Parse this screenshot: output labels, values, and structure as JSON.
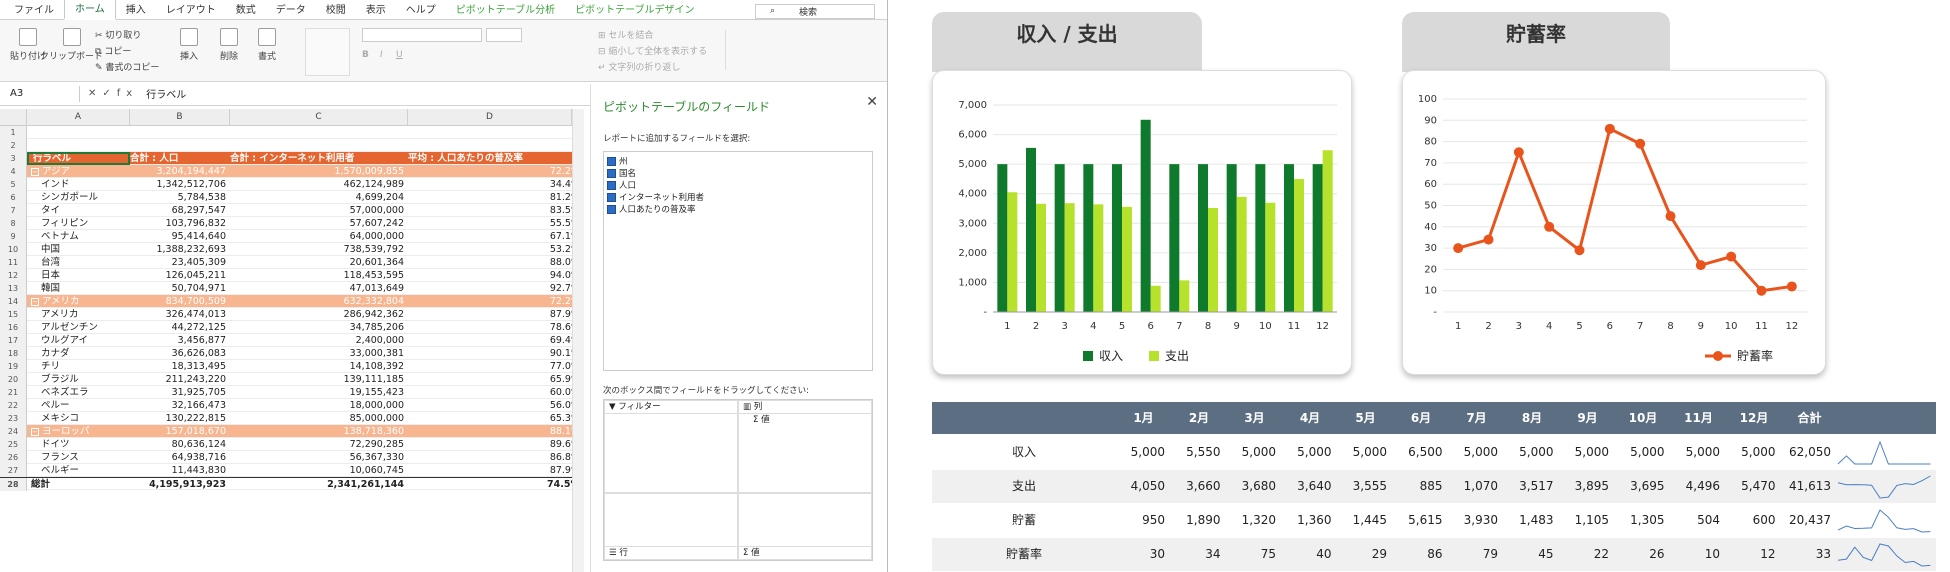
{
  "excel": {
    "tabs": [
      "ファイル",
      "ホーム",
      "挿入",
      "レイアウト",
      "数式",
      "データ",
      "校閲",
      "表示",
      "ヘルプ",
      "ピボットテーブル分析",
      "ピボットテーブルデザイン"
    ],
    "active_tab": "ホーム",
    "search_placeholder": "検索",
    "ribbon": {
      "paste": "貼り付け",
      "clipboard": "クリップボード",
      "cut": "切り取り",
      "copy": "コピー",
      "format_painter": "書式のコピー",
      "insert": "挿入",
      "delete": "削除",
      "format": "書式",
      "merge": "セルを結合",
      "shrink": "縮小して全体を表示する",
      "wrap": "文字列の折り返し"
    },
    "name_box": "A3",
    "formula": "行ラベル",
    "columns": [
      "A",
      "B",
      "C",
      "D"
    ],
    "header_row": {
      "a": "行ラベル",
      "b": "合計 : 人口",
      "c": "合計 : インターネット利用者",
      "d": "平均 : 人口あたりの普及率"
    },
    "rows": [
      {
        "n": "4",
        "a": "アジア",
        "b": "3,204,194,447",
        "c": "1,570,009,855",
        "d": "72.2%",
        "type": "grp"
      },
      {
        "n": "5",
        "a": "インド",
        "b": "1,342,512,706",
        "c": "462,124,989",
        "d": "34.4%"
      },
      {
        "n": "6",
        "a": "シンガポール",
        "b": "5,784,538",
        "c": "4,699,204",
        "d": "81.2%"
      },
      {
        "n": "7",
        "a": "タイ",
        "b": "68,297,547",
        "c": "57,000,000",
        "d": "83.5%"
      },
      {
        "n": "8",
        "a": "フィリピン",
        "b": "103,796,832",
        "c": "57,607,242",
        "d": "55.5%"
      },
      {
        "n": "9",
        "a": "ベトナム",
        "b": "95,414,640",
        "c": "64,000,000",
        "d": "67.1%"
      },
      {
        "n": "10",
        "a": "中国",
        "b": "1,388,232,693",
        "c": "738,539,792",
        "d": "53.2%"
      },
      {
        "n": "11",
        "a": "台湾",
        "b": "23,405,309",
        "c": "20,601,364",
        "d": "88.0%"
      },
      {
        "n": "12",
        "a": "日本",
        "b": "126,045,211",
        "c": "118,453,595",
        "d": "94.0%"
      },
      {
        "n": "13",
        "a": "韓国",
        "b": "50,704,971",
        "c": "47,013,649",
        "d": "92.7%"
      },
      {
        "n": "14",
        "a": "アメリカ",
        "b": "834,700,509",
        "c": "632,332,804",
        "d": "72.2%",
        "type": "grp"
      },
      {
        "n": "15",
        "a": "アメリカ",
        "b": "326,474,013",
        "c": "286,942,362",
        "d": "87.9%"
      },
      {
        "n": "16",
        "a": "アルゼンチン",
        "b": "44,272,125",
        "c": "34,785,206",
        "d": "78.6%"
      },
      {
        "n": "17",
        "a": "ウルグアイ",
        "b": "3,456,877",
        "c": "2,400,000",
        "d": "69.4%"
      },
      {
        "n": "18",
        "a": "カナダ",
        "b": "36,626,083",
        "c": "33,000,381",
        "d": "90.1%"
      },
      {
        "n": "19",
        "a": "チリ",
        "b": "18,313,495",
        "c": "14,108,392",
        "d": "77.0%"
      },
      {
        "n": "20",
        "a": "ブラジル",
        "b": "211,243,220",
        "c": "139,111,185",
        "d": "65.9%"
      },
      {
        "n": "21",
        "a": "ベネズエラ",
        "b": "31,925,705",
        "c": "19,155,423",
        "d": "60.0%"
      },
      {
        "n": "22",
        "a": "ペルー",
        "b": "32,166,473",
        "c": "18,000,000",
        "d": "56.0%"
      },
      {
        "n": "23",
        "a": "メキシコ",
        "b": "130,222,815",
        "c": "85,000,000",
        "d": "65.3%"
      },
      {
        "n": "24",
        "a": "ヨーロッパ",
        "b": "157,018,670",
        "c": "138,718,360",
        "d": "88.1%",
        "type": "grp"
      },
      {
        "n": "25",
        "a": "ドイツ",
        "b": "80,636,124",
        "c": "72,290,285",
        "d": "89.6%"
      },
      {
        "n": "26",
        "a": "フランス",
        "b": "64,938,716",
        "c": "56,367,330",
        "d": "86.8%"
      },
      {
        "n": "27",
        "a": "ベルギー",
        "b": "11,443,830",
        "c": "10,060,745",
        "d": "87.9%"
      },
      {
        "n": "28",
        "a": "総計",
        "b": "4,195,913,923",
        "c": "2,341,261,144",
        "d": "74.5%",
        "type": "total"
      }
    ],
    "pane": {
      "title": "ピボットテーブルのフィールド",
      "subtitle": "レポートに追加するフィールドを選択:",
      "fields": [
        "州",
        "国名",
        "人口",
        "インターネット利用者",
        "人口あたりの普及率"
      ],
      "drag_label": "次のボックス間でフィールドをドラッグしてください:",
      "filter": "フィルター",
      "columns": "列",
      "columns_value": "Σ 値",
      "rows": "行",
      "values": "値"
    }
  },
  "dashboard": {
    "chart1_title": "収入 / 支出",
    "chart2_title": "貯蓄率",
    "table_header": [
      "1月",
      "2月",
      "3月",
      "4月",
      "5月",
      "6月",
      "7月",
      "8月",
      "9月",
      "10月",
      "11月",
      "12月",
      "合計"
    ],
    "table_rows": [
      {
        "label": "収入",
        "values": [
          "5,000",
          "5,550",
          "5,000",
          "5,000",
          "5,000",
          "6,500",
          "5,000",
          "5,000",
          "5,000",
          "5,000",
          "5,000",
          "5,000",
          "62,050"
        ]
      },
      {
        "label": "支出",
        "values": [
          "4,050",
          "3,660",
          "3,680",
          "3,640",
          "3,555",
          "885",
          "1,070",
          "3,517",
          "3,895",
          "3,695",
          "4,496",
          "5,470",
          "41,613"
        ]
      },
      {
        "label": "貯蓄",
        "values": [
          "950",
          "1,890",
          "1,320",
          "1,360",
          "1,445",
          "5,615",
          "3,930",
          "1,483",
          "1,105",
          "1,305",
          "504",
          "600",
          "20,437"
        ]
      },
      {
        "label": "貯蓄率",
        "values": [
          "30",
          "34",
          "75",
          "40",
          "29",
          "86",
          "79",
          "45",
          "22",
          "26",
          "10",
          "12",
          "33"
        ]
      }
    ]
  },
  "chart_data": [
    {
      "type": "bar",
      "title": "収入 / 支出",
      "categories": [
        "1",
        "2",
        "3",
        "4",
        "5",
        "6",
        "7",
        "8",
        "9",
        "10",
        "11",
        "12"
      ],
      "series": [
        {
          "name": "収入",
          "values": [
            5000,
            5550,
            5000,
            5000,
            5000,
            6500,
            5000,
            5000,
            5000,
            5000,
            5000,
            5000
          ],
          "color": "#0f7a2c"
        },
        {
          "name": "支出",
          "values": [
            4050,
            3660,
            3680,
            3640,
            3555,
            885,
            1070,
            3517,
            3895,
            3695,
            4496,
            5470
          ],
          "color": "#b7e22b"
        }
      ],
      "ylim": [
        0,
        7000
      ],
      "yticks": [
        "-",
        "1,000",
        "2,000",
        "3,000",
        "4,000",
        "5,000",
        "6,000",
        "7,000"
      ],
      "legend": "bottom"
    },
    {
      "type": "line",
      "title": "貯蓄率",
      "categories": [
        "1",
        "2",
        "3",
        "4",
        "5",
        "6",
        "7",
        "8",
        "9",
        "10",
        "11",
        "12"
      ],
      "series": [
        {
          "name": "貯蓄率",
          "values": [
            30,
            34,
            75,
            40,
            29,
            86,
            79,
            45,
            22,
            26,
            10,
            12
          ],
          "color": "#e8541c"
        }
      ],
      "ylim": [
        0,
        100
      ],
      "yticks": [
        "-",
        "10",
        "20",
        "30",
        "40",
        "50",
        "60",
        "70",
        "80",
        "90",
        "100"
      ],
      "legend": "bottom"
    }
  ]
}
